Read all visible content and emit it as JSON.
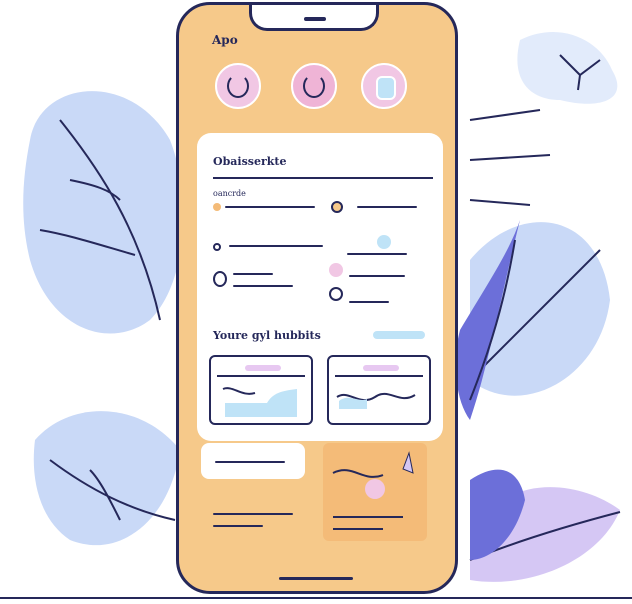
{
  "app": {
    "label": "Apo"
  },
  "card": {
    "title": "Obaisserkte",
    "subtitle": "oancrde",
    "habits_title": "Youre gyl hubbits"
  },
  "colors": {
    "phone_bg": "#f6c98a",
    "outline": "#25285a",
    "leaf_light": "#c9d9f7",
    "leaf_dark": "#6c6fd9",
    "leaf_lilac": "#d5c7f4",
    "accent_pink": "#f1c7e4",
    "accent_blue": "#bfe3f7"
  },
  "icons": [
    "app-circle-icon",
    "wave-chart-icon",
    "leaf-icon"
  ]
}
